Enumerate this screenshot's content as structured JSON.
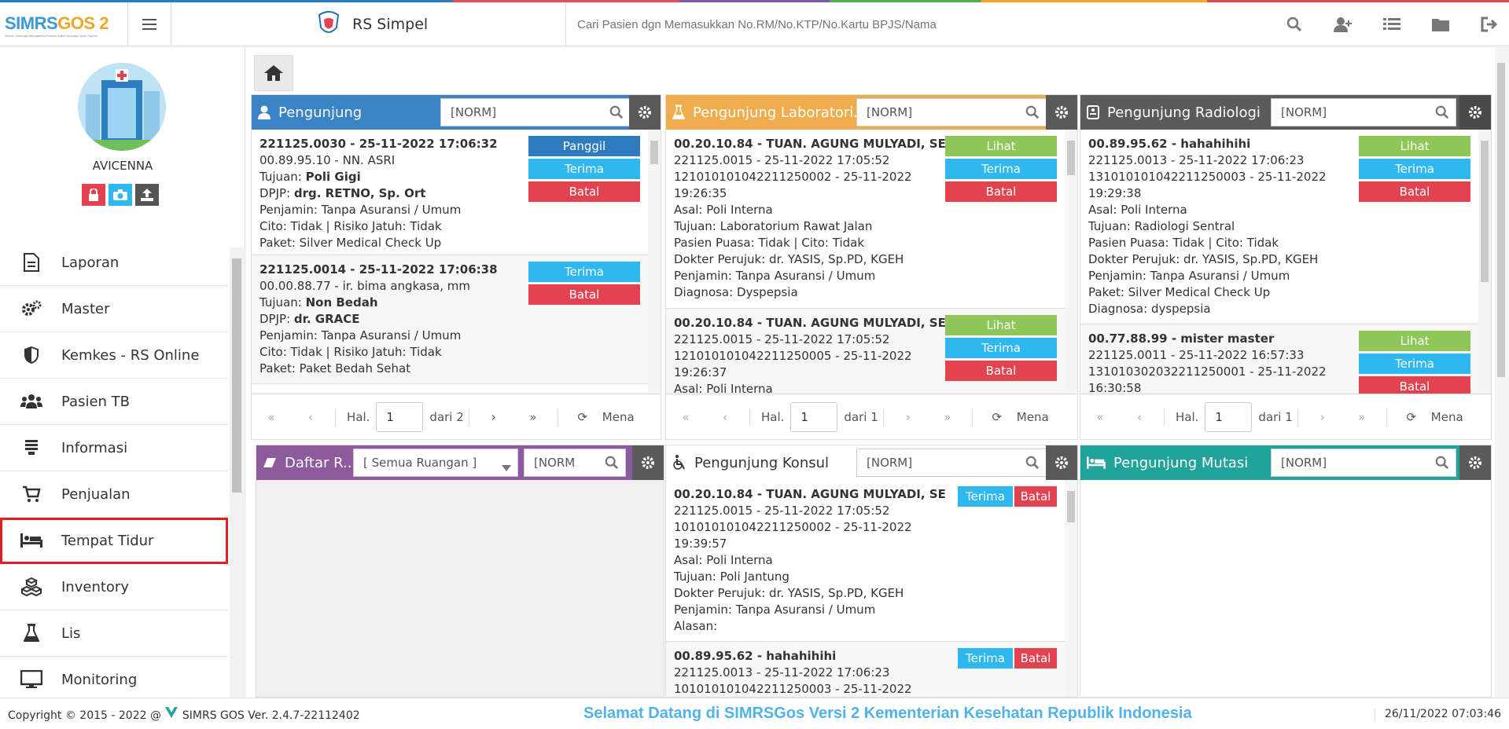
{
  "header": {
    "logo_text": "SIMRS",
    "logo_accent": "GOS 2",
    "logo_sub": "Sistem Informasi Manajemen Rumah Sakit Generasi Open Source",
    "app_name": "RS Simpel",
    "search_placeholder": "Cari Pasien dgn Memasukkan No.RM/No.KTP/No.Kartu BPJS/Nama",
    "icons": [
      "search-icon",
      "add-user-icon",
      "list-icon",
      "folder-icon",
      "logout-icon"
    ]
  },
  "sidebar": {
    "username": "AVICENNA",
    "user_buttons": [
      {
        "icon": "lock-icon",
        "color": "#e2434f"
      },
      {
        "icon": "camera-icon",
        "color": "#2eb8ef"
      },
      {
        "icon": "upload-icon",
        "color": "#555555"
      }
    ],
    "items": [
      {
        "label": "Laporan",
        "icon": "document-icon"
      },
      {
        "label": "Master",
        "icon": "gears-icon"
      },
      {
        "label": "Kemkes - RS Online",
        "icon": "shield-icon"
      },
      {
        "label": "Pasien TB",
        "icon": "users-icon"
      },
      {
        "label": "Informasi",
        "icon": "info-list-icon"
      },
      {
        "label": "Penjualan",
        "icon": "cart-icon"
      },
      {
        "label": "Tempat Tidur",
        "icon": "bed-icon",
        "active": true
      },
      {
        "label": "Inventory",
        "icon": "cubes-icon"
      },
      {
        "label": "Lis",
        "icon": "flask-icon"
      },
      {
        "label": "Monitoring",
        "icon": "monitor-icon"
      }
    ]
  },
  "panels": {
    "pengunjung": {
      "title": "Pengunjung",
      "search": "[NORM]",
      "color": "#3a84c6",
      "records": [
        {
          "l1": "221125.0030 - 25-11-2022 17:06:32",
          "l2": "00.89.95.10 - NN. ASRI",
          "l3a": "Tujuan: ",
          "l3b": "Poli Gigi",
          "l4a": "DPJP: ",
          "l4b": "drg. RETNO, Sp. Ort",
          "l5": "Penjamin: Tanpa Asuransi / Umum",
          "l6": "Cito: Tidak | Risiko Jatuh: Tidak",
          "l7": "Paket: Silver Medical Check Up",
          "btns": [
            "Panggil",
            "Terima",
            "Batal"
          ]
        },
        {
          "l1": "221125.0014 - 25-11-2022 17:06:38",
          "l2": "00.00.88.77 - ir. bima angkasa, mm",
          "l3a": "Tujuan: ",
          "l3b": "Non Bedah",
          "l4a": "DPJP: ",
          "l4b": "dr. GRACE",
          "l5": "Penjamin: Tanpa Asuransi / Umum",
          "l6": "Cito: Tidak | Risiko Jatuh: Tidak",
          "l7": "Paket: Paket Bedah Sehat",
          "btns": [
            "Terima",
            "Batal"
          ]
        }
      ],
      "pager": {
        "hal": "Hal.",
        "page": "1",
        "of": "dari 2",
        "more": "Menampilkan"
      }
    },
    "laboratorium": {
      "title": "Pengunjung Laboratori...",
      "search": "[NORM]",
      "color": "#f0ad4e",
      "records": [
        {
          "l1": "00.20.10.84 - TUAN. AGUNG MULYADI, SE",
          "lines": [
            "221125.0015 - 25-11-2022 17:05:52",
            "121010101042211250002 - 25-11-2022",
            "19:26:35",
            "Asal: Poli Interna",
            "Tujuan: Laboratorium Rawat Jalan",
            "Pasien Puasa: Tidak | Cito: Tidak",
            "Dokter Perujuk: dr. YASIS, Sp.PD, KGEH",
            "Penjamin: Tanpa Asuransi / Umum",
            "Diagnosa: Dyspepsia"
          ],
          "btns": [
            "Lihat",
            "Terima",
            "Batal"
          ]
        },
        {
          "l1": "00.20.10.84 - TUAN. AGUNG MULYADI, SE",
          "lines": [
            "221125.0015 - 25-11-2022 17:05:52",
            "121010101042211250005 - 25-11-2022",
            "19:26:37",
            "Asal: Poli Interna"
          ],
          "btns": [
            "Lihat",
            "Terima",
            "Batal"
          ]
        }
      ],
      "pager": {
        "hal": "Hal.",
        "page": "1",
        "of": "dari 1",
        "more": "Menampilkan"
      }
    },
    "radiologi": {
      "title": "Pengunjung Radiologi",
      "search": "[NORM]",
      "color": "#5b5b5b",
      "records": [
        {
          "l1": "00.89.95.62 - hahahihihi",
          "lines": [
            "221125.0013 - 25-11-2022 17:06:23",
            "131010101042211250003 - 25-11-2022",
            "19:29:38",
            "Asal: Poli Interna",
            "Tujuan: Radiologi Sentral",
            "Pasien Puasa: Tidak | Cito: Tidak",
            "Dokter Perujuk: dr. YASIS, Sp.PD, KGEH",
            "Penjamin: Tanpa Asuransi / Umum",
            "Paket: Silver Medical Check Up",
            "Diagnosa: dyspepsia"
          ],
          "btns": [
            "Lihat",
            "Terima",
            "Batal"
          ]
        },
        {
          "l1": "00.77.88.99 - mister master",
          "lines": [
            "221125.0011 - 25-11-2022 16:57:33",
            "131010302032211250001 - 25-11-2022",
            "16:30:58"
          ],
          "btns": [
            "Lihat",
            "Terima",
            "Batal"
          ]
        }
      ],
      "pager": {
        "hal": "Hal.",
        "page": "1",
        "of": "dari 1",
        "more": "Menampilkan"
      }
    },
    "daftar_ruangan": {
      "title": "Daftar R...",
      "select": "[ Semua Ruangan ]",
      "search": "[NORM",
      "color": "#8e5a9e"
    },
    "konsul": {
      "title": "Pengunjung Konsul",
      "search": "[NORM]",
      "records": [
        {
          "l1": "00.20.10.84 - TUAN. AGUNG MULYADI, SE",
          "lines": [
            "221125.0015 - 25-11-2022 17:05:52",
            "101010101042211250002 - 25-11-2022",
            "19:39:57",
            "Asal: Poli Interna",
            "Tujuan: Poli Jantung",
            "Dokter Perujuk: dr. YASIS, Sp.PD, KGEH",
            "Penjamin: Tanpa Asuransi / Umum",
            "Alasan:"
          ],
          "btns": [
            "Terima",
            "Batal"
          ]
        },
        {
          "l1": "00.89.95.62 - hahahihihi",
          "lines": [
            "221125.0013 - 25-11-2022 17:06:23",
            "101010101042211250003 - 25-11-2022"
          ],
          "btns": [
            "Terima",
            "Batal"
          ]
        }
      ]
    },
    "mutasi": {
      "title": "Pengunjung Mutasi",
      "search": "[NORM]",
      "color": "#1fa39a"
    }
  },
  "footer": {
    "copyright": "Copyright © 2015 - 2022 @ ",
    "version": "SIMRS GOS Ver. 2.4.7-22112402",
    "marquee": "Selamat Datang di SIMRSGos Versi 2 Kementerian Kesehatan Republik Indonesia",
    "datetime": "26/11/2022 07:03:46"
  }
}
